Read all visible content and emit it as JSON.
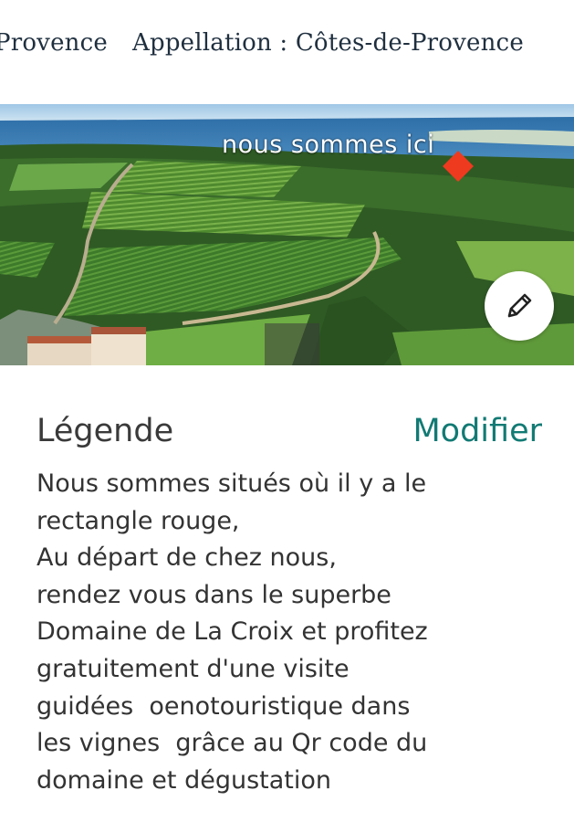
{
  "header": {
    "crumb_left": "Provence",
    "crumb_right": "Appellation : Côtes-de-Provence"
  },
  "photo": {
    "caption": "nous sommes ici",
    "marker_color": "#ee3a1f",
    "edit_icon": "pencil-icon"
  },
  "legend": {
    "title": "Légende",
    "modify_label": "Modifier",
    "accent_color": "#127a74",
    "lines": [
      "Nous sommes situés où il y a le",
      "rectangle rouge,",
      "Au départ de chez nous,",
      "rendez vous dans le superbe",
      "Domaine de La Croix et profitez",
      "gratuitement d'une visite",
      "guidées  oenotouristique dans",
      "les vignes  grâce au Qr code du",
      "domaine et dégustation"
    ]
  }
}
